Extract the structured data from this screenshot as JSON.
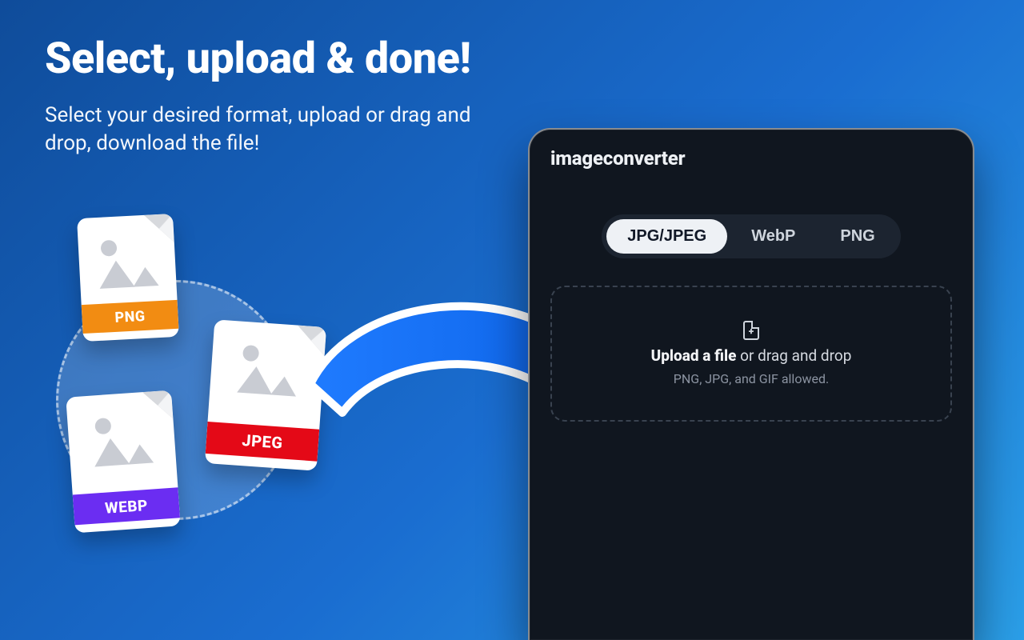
{
  "hero": {
    "title": "Select, upload & done!",
    "subtitle": "Select your desired format, upload or drag and drop, download the file!"
  },
  "files": {
    "png_label": "PNG",
    "jpeg_label": "JPEG",
    "webp_label": "WEBP"
  },
  "panel": {
    "app_name": "imageconverter",
    "tabs": {
      "jpg": "JPG/JPEG",
      "webp": "WebP",
      "png": "PNG"
    },
    "active_tab": "jpg",
    "drop": {
      "bold": "Upload a file",
      "rest": " or drag and drop",
      "hint": "PNG, JPG, and GIF allowed."
    }
  }
}
